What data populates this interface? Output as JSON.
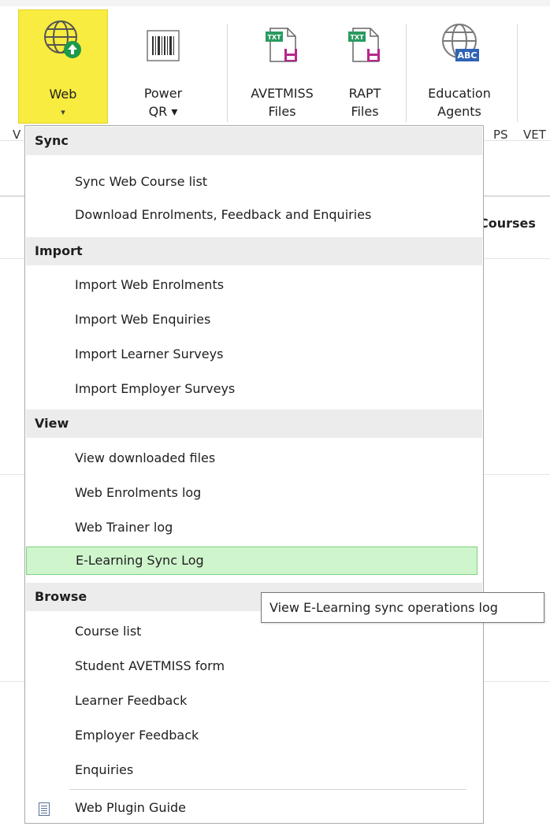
{
  "ribbon": {
    "buttons": [
      {
        "label": "Web",
        "arrow": "▾",
        "icon": "globe-upload-icon"
      },
      {
        "label_line1": "Power",
        "label_line2": "QR ▾",
        "icon": "barcode-icon"
      },
      {
        "label_line1": "AVETMISS",
        "label_line2": "Files",
        "icon": "txt-file-save-icon"
      },
      {
        "label_line1": "RAPT",
        "label_line2": "Files",
        "icon": "txt-file-save-icon"
      },
      {
        "label_line1": "Education",
        "label_line2": "Agents",
        "icon": "globe-abc-icon"
      }
    ],
    "txt_badge": "TXT",
    "abc_badge": "ABC",
    "group_label_left": "V",
    "group_label_mid": "PS",
    "group_label_right": "VET"
  },
  "background": {
    "courses_header": "Courses"
  },
  "menu": {
    "sections": [
      {
        "header": "Sync",
        "items": [
          "Sync Web Course list",
          "Download Enrolments, Feedback and Enquiries"
        ]
      },
      {
        "header": "Import",
        "items": [
          "Import Web Enrolments",
          "Import Web Enquiries",
          "Import Learner Surveys",
          "Import Employer Surveys"
        ]
      },
      {
        "header": "View",
        "items": [
          "View downloaded files",
          "Web Enrolments log",
          "Web Trainer log",
          "E-Learning Sync Log"
        ]
      },
      {
        "header": "Browse",
        "items": [
          "Course list",
          "Student AVETMISS form",
          "Learner Feedback",
          "Employer Feedback",
          "Enquiries"
        ]
      }
    ],
    "footer_item": "Web Plugin Guide",
    "highlighted_item": "E-Learning Sync Log"
  },
  "tooltip": "View E-Learning sync operations log",
  "colors": {
    "web_button_bg": "#f7ec3f",
    "highlight_bg": "#cff5cd",
    "section_header_bg": "#ececec"
  }
}
